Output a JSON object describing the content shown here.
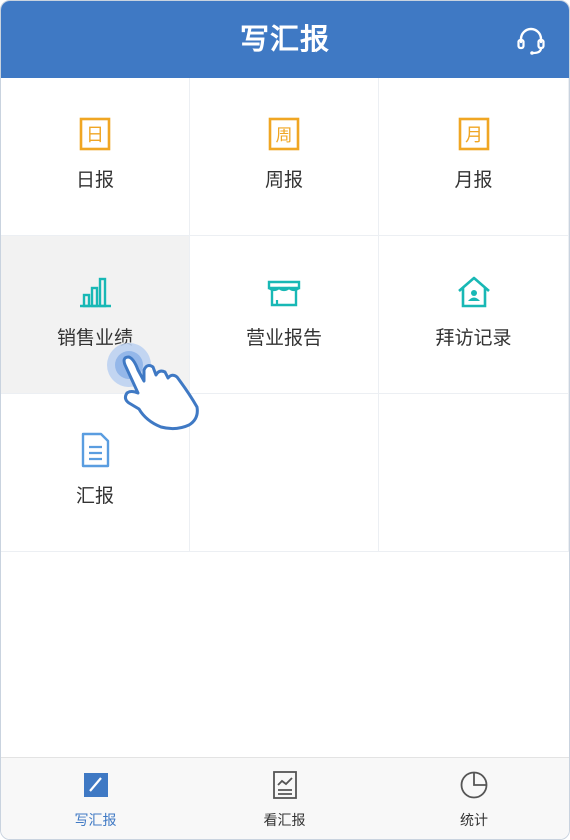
{
  "header": {
    "title": "写汇报"
  },
  "report_types": [
    {
      "label": "日报",
      "icon_char": "日"
    },
    {
      "label": "周报",
      "icon_char": "周"
    },
    {
      "label": "月报",
      "icon_char": "月"
    },
    {
      "label": "销售业绩"
    },
    {
      "label": "营业报告"
    },
    {
      "label": "拜访记录"
    },
    {
      "label": "汇报"
    }
  ],
  "tabbar": {
    "items": [
      {
        "label": "写汇报",
        "active": true
      },
      {
        "label": "看汇报",
        "active": false
      },
      {
        "label": "统计",
        "active": false
      }
    ]
  },
  "colors": {
    "header_bg": "#3f79c4",
    "calendar_icon": "#f0a623",
    "teal_icon": "#18b8b5",
    "doc_icon": "#5a9de0",
    "active_tab": "#3f79c4"
  },
  "icons": {
    "support": "headset-icon",
    "daily": "calendar-day-icon",
    "weekly": "calendar-week-icon",
    "monthly": "calendar-month-icon",
    "sales": "bar-chart-icon",
    "business": "store-icon",
    "visit": "home-person-icon",
    "report": "document-icon",
    "tab_write": "edit-square-icon",
    "tab_view": "report-chart-icon",
    "tab_stats": "pie-chart-icon",
    "pointer": "tap-hand-icon"
  }
}
